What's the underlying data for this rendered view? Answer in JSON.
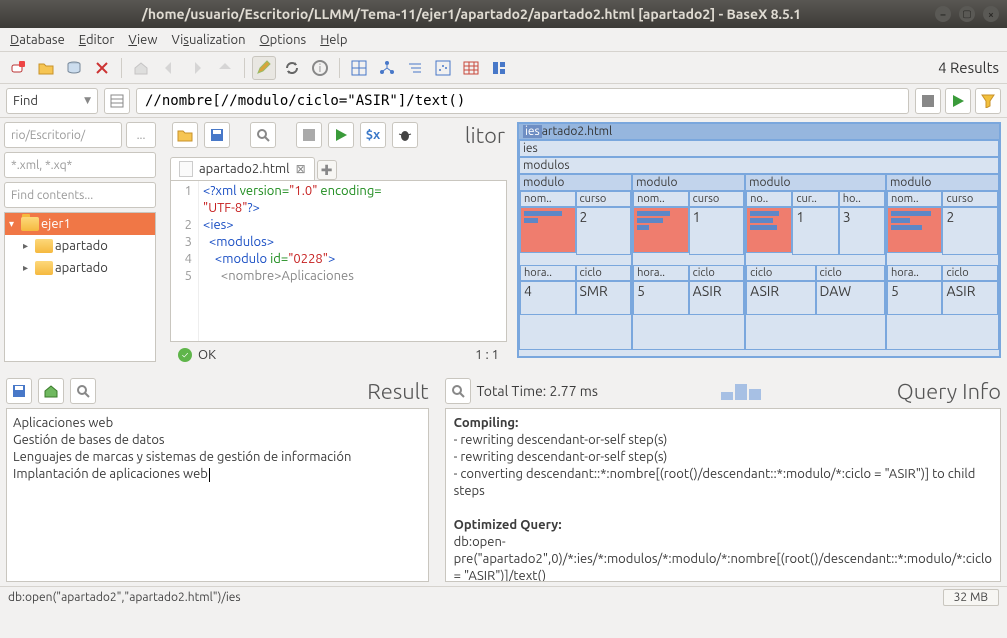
{
  "window": {
    "title": "/home/usuario/Escritorio/LLMM/Tema-11/ejer1/apartado2/apartado2.html [apartado2] - BaseX 8.5.1"
  },
  "menu": {
    "database": "Database",
    "editor": "Editor",
    "view": "View",
    "visualization": "Visualization",
    "options": "Options",
    "help": "Help"
  },
  "toolbar": {
    "results": "4 Results"
  },
  "querybar": {
    "find": "Find",
    "query": "//nombre[//modulo/ciclo=\"ASIR\"]/text()"
  },
  "filepanel": {
    "path_hint": "rio/Escritorio/",
    "more": "...",
    "filter_hint": "*.xml, *.xq*",
    "search_hint": "Find contents...",
    "tree": [
      {
        "label": "ejer1",
        "selected": true,
        "indent": 0
      },
      {
        "label": "apartado",
        "indent": 1
      },
      {
        "label": "apartado",
        "indent": 1
      }
    ]
  },
  "editor": {
    "panel_title": "litor",
    "tab": {
      "label": "apartado2.html"
    },
    "code_lines": [
      "<?xml version=\"1.0\" encoding=\"UTF-8\"?>",
      "<ies>",
      "  <modulos>",
      "    <modulo id=\"0228\">",
      "      <nombre>Aplicaciones"
    ],
    "status_ok": "OK",
    "status_pos": "1 : 1"
  },
  "map": {
    "root": "iesartado2.html",
    "ies": "ies",
    "modulos": "modulos",
    "mod_label": "modulo",
    "nom_label": "nom..",
    "curso_label": "curso",
    "hora_label": "hora..",
    "ciclo_label": "ciclo",
    "no_label": "no..",
    "cur_label": "cur..",
    "ho_label": "ho..",
    "modules": [
      {
        "curso": "2",
        "horas": "4",
        "ciclo": "SMR"
      },
      {
        "curso": "1",
        "horas": "5",
        "ciclo": "ASIR"
      },
      {
        "curso": "1",
        "horas_extra": "3",
        "ciclo": "ASIR",
        "ciclo2": "DAW"
      },
      {
        "curso": "2",
        "horas": "5",
        "ciclo": "ASIR"
      }
    ]
  },
  "result": {
    "title": "Result",
    "lines": [
      "Aplicaciones web",
      "Gestión de bases de datos",
      "Lenguajes de marcas y sistemas de gestión de información",
      "Implantación de aplicaciones web"
    ]
  },
  "queryinfo": {
    "title": "Query Info",
    "total_time": "Total Time: 2.77 ms",
    "compiling_hdr": "Compiling:",
    "compiling": [
      "- rewriting descendant-or-self step(s)",
      "- rewriting descendant-or-self step(s)",
      "- converting descendant::*:nombre[(root()/descendant::*:modulo/*:ciclo = \"ASIR\")] to child steps"
    ],
    "optimized_hdr": "Optimized Query:",
    "optimized": "db:open-pre(\"apartado2\",0)/*:ies/*:modulos/*:modulo/*:nombre[(root()/descendant::*:modulo/*:ciclo = \"ASIR\")]/text()"
  },
  "status": {
    "left": "db:open(\"apartado2\",\"apartado2.html\")/ies",
    "mem": "32 MB"
  }
}
